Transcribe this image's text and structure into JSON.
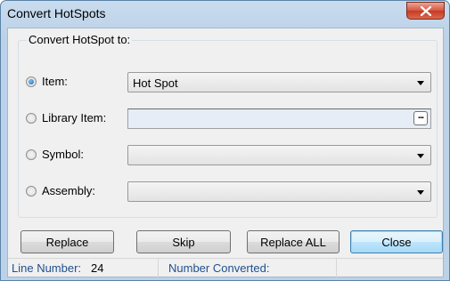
{
  "window": {
    "title": "Convert HotSpots",
    "close_icon": "close-x-icon"
  },
  "group": {
    "legend": "Convert HotSpot to:",
    "options": [
      {
        "label": "Item:",
        "checked": true,
        "control": "combo",
        "value": "Hot Spot"
      },
      {
        "label": "Library Item:",
        "checked": false,
        "control": "edit",
        "value": "",
        "browse_label": "..."
      },
      {
        "label": "Symbol:",
        "checked": false,
        "control": "combo",
        "value": ""
      },
      {
        "label": "Assembly:",
        "checked": false,
        "control": "combo",
        "value": ""
      }
    ]
  },
  "buttons": {
    "replace": "Replace",
    "skip": "Skip",
    "replace_all": "Replace ALL",
    "close": "Close"
  },
  "status": {
    "line_number_label": "Line Number:",
    "line_number_value": "24",
    "number_converted_label": "Number Converted:",
    "number_converted_value": ""
  },
  "colors": {
    "title_bar": "#bcd2e8",
    "close_button": "#c63a22",
    "status_text": "#1f4f8f"
  }
}
